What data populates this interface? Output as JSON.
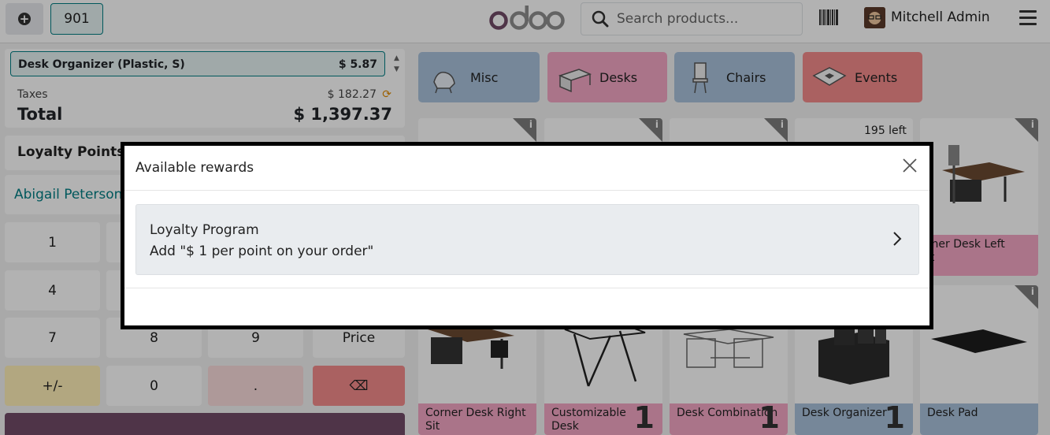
{
  "topbar": {
    "order_number": "901",
    "search_placeholder": "Search products...",
    "user_name": "Mitchell Admin",
    "logo_text": "odoo"
  },
  "order": {
    "line_name": "Desk Organizer (Plastic, S)",
    "line_price": "$ 5.87",
    "taxes_label": "Taxes",
    "taxes_value": "$ 182.27",
    "total_label": "Total",
    "total_value": "$ 1,397.37"
  },
  "loyalty": {
    "label": "Loyalty Points"
  },
  "customer": {
    "name": "Abigail Peterson"
  },
  "numpad": {
    "k1": "1",
    "k4": "4",
    "k7": "7",
    "k8": "8",
    "k9": "9",
    "price": "Price",
    "plusminus": "+/-",
    "zero": "0",
    "dot": ".",
    "backspace": "⌫"
  },
  "categories": [
    {
      "label": "Misc",
      "color": "#a9c2dc"
    },
    {
      "label": "Desks",
      "color": "#f4a6c4"
    },
    {
      "label": "Chairs",
      "color": "#a9c2dc"
    },
    {
      "label": "Events",
      "color": "#f48c8c"
    }
  ],
  "products": {
    "stock_badge": "195 left",
    "corner_desk_left": "rner Desk Left",
    "corner_desk_left_2": "it",
    "corner_desk_right": "Corner Desk Right Sit",
    "customizable_desk": "Customizable Desk",
    "desk_combination": "Desk Combination",
    "desk_organizer": "Desk Organizer",
    "desk_pad": "Desk Pad",
    "qty_customizable": "1",
    "qty_combination": "1",
    "qty_organizer": "1"
  },
  "modal": {
    "title": "Available rewards",
    "reward_title": "Loyalty Program",
    "reward_desc": "Add \"$ 1 per point on your order\""
  },
  "colors": {
    "brand": "#714b67",
    "accent": "#017e84"
  }
}
